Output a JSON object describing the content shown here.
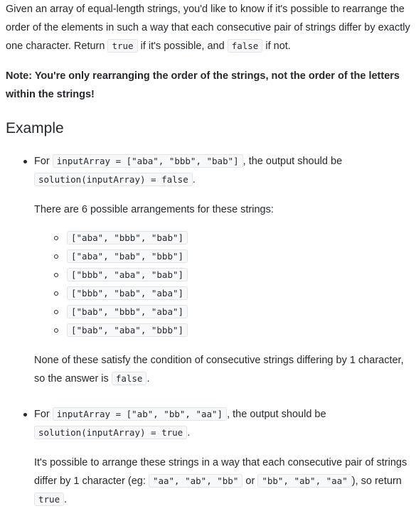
{
  "intro": {
    "text1": "Given an array of equal-length strings, you'd like to know if it's possible to rearrange the order of the elements in such a way that each consecutive pair of strings differ by exactly one character. Return ",
    "code_true": "true",
    "text2": " if it's possible, and ",
    "code_false": "false",
    "text3": " if not."
  },
  "note": "Note: You're only rearranging the order of the strings, not the order of the letters within the strings!",
  "heading": "Example",
  "example1": {
    "for_label": "For ",
    "input_code": "inputArray = [\"aba\", \"bbb\", \"bab\"]",
    "output_text": ", the output should be",
    "solution_code": "solution(inputArray) = false",
    "period": ".",
    "arrangements_intro": "There are 6 possible arrangements for these strings:",
    "arrangements": [
      "[\"aba\", \"bbb\", \"bab\"]",
      "[\"aba\", \"bab\", \"bbb\"]",
      "[\"bbb\", \"aba\", \"bab\"]",
      "[\"bbb\", \"bab\", \"aba\"]",
      "[\"bab\", \"bbb\", \"aba\"]",
      "[\"bab\", \"aba\", \"bbb\"]"
    ],
    "conclusion_text": "None of these satisfy the condition of consecutive strings differing by 1 character, so the answer is ",
    "conclusion_code": "false",
    "conclusion_period": "."
  },
  "example2": {
    "for_label": "For ",
    "input_code": "inputArray = [\"ab\", \"bb\", \"aa\"]",
    "output_text": ", the output should be",
    "solution_code": "solution(inputArray) = true",
    "period": ".",
    "explain_text1": "It's possible to arrange these strings in a way that each consecutive pair of strings differ by 1 character (eg: ",
    "explain_code1": "\"aa\", \"ab\", \"bb\"",
    "explain_or": " or ",
    "explain_code2": "\"bb\", \"ab\", \"aa\"",
    "explain_text2": "), so return ",
    "explain_code3": "true",
    "explain_period": "."
  }
}
